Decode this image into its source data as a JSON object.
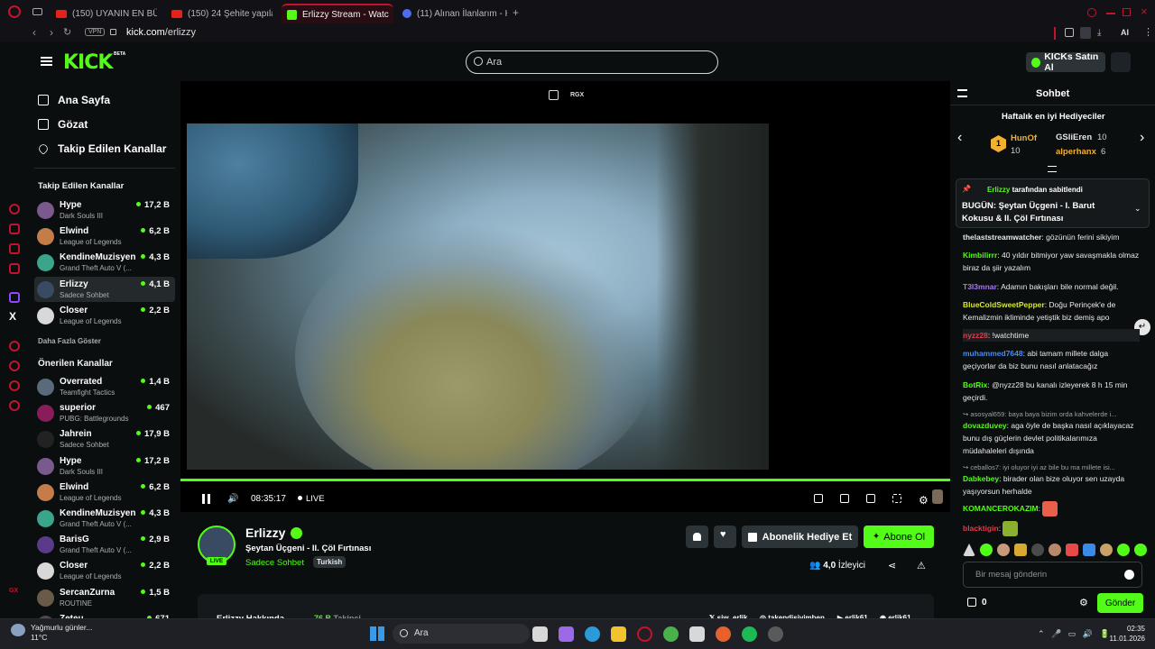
{
  "browser": {
    "tabs": [
      {
        "label": "(150) UYANIN EN BÜYÜK",
        "type": "youtube"
      },
      {
        "label": "(150) 24 Şehite yapılan ra",
        "type": "youtube"
      },
      {
        "label": "Erlizzy Stream - Watc",
        "type": "kick",
        "active": true
      },
      {
        "label": "(11) Alınan İlanlarım - Hes",
        "type": "other"
      }
    ],
    "vpn_label": "VPN",
    "url_host": "kick.com",
    "url_path": "/erlizzy",
    "ai_label": "AI"
  },
  "header": {
    "logo": "KICK",
    "logo_badge": "BETA",
    "search_placeholder": "Ara",
    "buy_kicks": "KICKs Satın Al"
  },
  "sidebar": {
    "nav": [
      {
        "label": "Ana Sayfa",
        "icon": "home-icon"
      },
      {
        "label": "Gözat",
        "icon": "browse-icon"
      },
      {
        "label": "Takip Edilen Kanallar",
        "icon": "heart-icon"
      }
    ],
    "followed_heading": "Takip Edilen Kanallar",
    "followed": [
      {
        "name": "Hype",
        "game": "Dark Souls III",
        "viewers": "17,2 B",
        "color": "#7a5a8c"
      },
      {
        "name": "Elwind",
        "game": "League of Legends",
        "viewers": "6,2 B",
        "color": "#c47c48"
      },
      {
        "name": "KendineMuzisyen",
        "game": "Grand Theft Auto V (...",
        "viewers": "4,3 B",
        "color": "#3aa58a"
      },
      {
        "name": "Erlizzy",
        "game": "Sadece Sohbet",
        "viewers": "4,1 B",
        "color": "#394b63",
        "selected": true
      },
      {
        "name": "Closer",
        "game": "League of Legends",
        "viewers": "2,2 B",
        "color": "#d8d8d8"
      }
    ],
    "show_more": "Daha Fazla Göster",
    "recommended_heading": "Önerilen Kanallar",
    "recommended": [
      {
        "name": "Overrated",
        "game": "Teamfight Tactics",
        "viewers": "1,4 B",
        "color": "#5a6a7a"
      },
      {
        "name": "superior",
        "game": "PUBG: Battlegrounds",
        "viewers": "467",
        "color": "#8a1c5c"
      },
      {
        "name": "Jahrein",
        "game": "Sadece Sohbet",
        "viewers": "17,9 B",
        "color": "#222222"
      },
      {
        "name": "Hype",
        "game": "Dark Souls III",
        "viewers": "17,2 B",
        "color": "#7a5a8c"
      },
      {
        "name": "Elwind",
        "game": "League of Legends",
        "viewers": "6,2 B",
        "color": "#c47c48"
      },
      {
        "name": "KendineMuzisyen",
        "game": "Grand Theft Auto V (...",
        "viewers": "4,3 B",
        "color": "#3aa58a"
      },
      {
        "name": "BarisG",
        "game": "Grand Theft Auto V (...",
        "viewers": "2,9 B",
        "color": "#5a3a8a"
      },
      {
        "name": "Closer",
        "game": "League of Legends",
        "viewers": "2,2 B",
        "color": "#d8d8d8"
      },
      {
        "name": "SercanZurna",
        "game": "ROUTINE",
        "viewers": "1,5 B",
        "color": "#6a5a4a"
      },
      {
        "name": "Zeteu",
        "game": "",
        "viewers": "671",
        "color": "#4a4a4a"
      }
    ]
  },
  "player": {
    "overlay_label": "RGX",
    "timecode": "08:35:17",
    "live_label": "LIVE",
    "progress": 1.0
  },
  "stream": {
    "channel": "Erlizzy",
    "live_pill": "LIVE",
    "title": "Şeytan Üçgeni - II. Çöl Fırtınası",
    "category": "Sadece Sohbet",
    "language": "Turkish",
    "gift_sub": "Abonelik Hediye Et",
    "subscribe": "Abone Ol",
    "viewer_count": "4,0",
    "viewer_label": "İzleyici",
    "about": "Erlizzy Hakkında",
    "followers": "76 B",
    "followers_label": "Takipçi",
    "socials": [
      "siw_erlik",
      "takendisivimben",
      "erlik61",
      "erlik61"
    ]
  },
  "chat": {
    "title": "Sohbet",
    "gifters_heading": "Haftalık en iyi Hediyeciler",
    "gifters": [
      {
        "rank": "1",
        "name": "HunOf",
        "count": "10",
        "color": "#f2b230"
      },
      {
        "name": "GSliEren",
        "count": "10",
        "color": "#e6e6e6"
      },
      {
        "name": "alperhanx",
        "count": "6",
        "color": "#f2b230"
      }
    ],
    "pinned_by_user": "Erlizzy",
    "pinned_by_text": "tarafından sabitlendi",
    "pinned_message": "BUGÜN: Şeytan Üçgeni - I. Barut Kokusu & II. Çöl Fırtınası",
    "messages": [
      {
        "user": "thelaststreamwatcher",
        "color": "#e6e6e6",
        "text": "gözünün ferini sikiyim"
      },
      {
        "user": "Kimbilirrr",
        "color": "#53fc18",
        "text": "40 yıldır bitmiyor yaw savaşmakla olmaz biraz da şiir yazalım"
      },
      {
        "user": "T3l3mnar",
        "color": "#a678f0",
        "text": "Adamın bakışları bile normal değil."
      },
      {
        "user": "BlueColdSweetPepper",
        "color": "#d6e82a",
        "text": "Doğu Perinçek'e de Kemalizmin ikliminde yetiştik biz demiş apo"
      },
      {
        "user": "nyzz28",
        "color": "#e83a4a",
        "text": "!watchtime"
      },
      {
        "user": "muhammed7648",
        "color": "#4a8cf0",
        "text": "abi tamam millete dalga geçiyorlar da biz bunu nasıl anlatacağız"
      },
      {
        "user": "BotRix",
        "color": "#53fc18",
        "text": "@nyzz28 bu kanalı izleyerek 8 h 15 min geçirdi."
      },
      {
        "reply": "asosyal659: baya baya bizim orda kahvelerde i..."
      },
      {
        "user": "dovazduvey",
        "color": "#53fc18",
        "text": "aga öyle de başka nasıl açıklayacaz bunu dış güçlerin devlet politikalarımıza müdahaleleri dışında"
      },
      {
        "reply": "ceballos7: iyi oluyor iyi az bile bu ma millete isi..."
      },
      {
        "user": "Dabkebey",
        "color": "#53fc18",
        "text": "birader olan bize oluyor sen uzayda yaşıyorsun herhalde"
      },
      {
        "user": "KOMANCEROKAZIM",
        "color": "#53fc18",
        "text": ""
      },
      {
        "user": "blacktigin",
        "color": "#e83a4a",
        "text": ""
      }
    ],
    "input_placeholder": "Bir mesaj gönderin",
    "points": "0",
    "send": "Gönder"
  },
  "taskbar": {
    "weather_line1": "Yağmurlu günler...",
    "weather_line2": "11°C",
    "search_label": "Ara",
    "time": "02:35",
    "date": "11.01.2026"
  }
}
